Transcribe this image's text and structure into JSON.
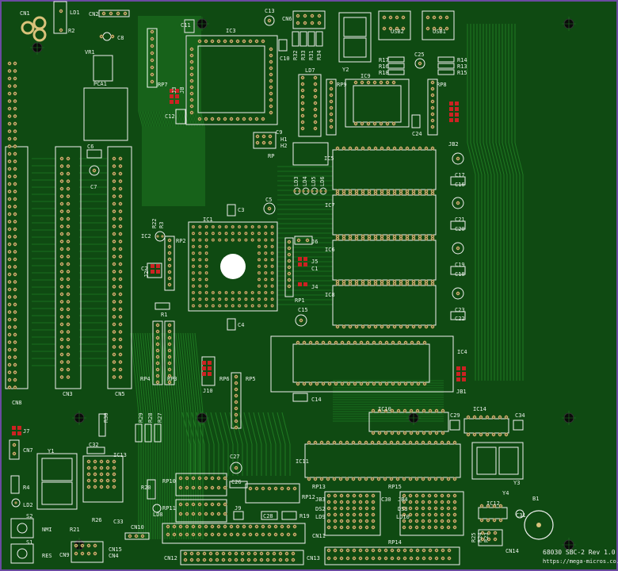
{
  "board": {
    "title": "68030 SBC-2 Rev 1.0",
    "url": "https://mega-micros.co.uk",
    "colors": {
      "substrate": "#0f4a12",
      "trace": "#1f7a22",
      "copper": "#d9c27a",
      "silk": "#f0f0f0",
      "jumper": "#cc2222",
      "hole": "#0a0a0a"
    }
  },
  "labels": {
    "cn1": "CN1",
    "ld1": "LD1",
    "r2": "R2",
    "cn2": "CN2",
    "c8": "C8",
    "vr1": "VR1",
    "pca1": "PCA1",
    "c11": "C11",
    "ic3": "IC3",
    "c13": "C13",
    "c10": "C10",
    "cn6": "CN6",
    "r32": "R32",
    "r33": "R33",
    "r31": "R31",
    "r34": "R34",
    "y2": "Y2",
    "usb2": "USB2",
    "usb1": "USB1",
    "c25": "C25",
    "r17": "R17",
    "r16": "R16",
    "r18": "R18",
    "r14": "R14",
    "r13": "R13",
    "r15": "R15",
    "rp7": "RP7",
    "j3": "J3",
    "jb": "JB",
    "c12": "C12",
    "ld7": "LD7",
    "rp9": "RP9",
    "ic9": "IC9",
    "rp8": "RP8",
    "c24": "C24",
    "jb2": "JB2",
    "c9": "C9",
    "h1": "H1",
    "h2": "H2",
    "rp": "RP",
    "ic5": "IC5",
    "ld3": "LD3",
    "ld4": "LD4",
    "ld5": "LD5",
    "ld6": "LD6",
    "c6": "C6",
    "c7": "C7",
    "cn8": "CN8",
    "cn3": "CN3",
    "cn5": "CN5",
    "c17": "C17",
    "c16": "C16",
    "c21": "C21",
    "c20": "C20",
    "c19": "C19",
    "c18": "C18",
    "c23": "C23",
    "c22": "C22",
    "ic7": "IC7",
    "ic6": "IC6",
    "ic8": "IC8",
    "c5": "C5",
    "c3": "C3",
    "ic1": "IC1",
    "r22": "R22",
    "r3": "R3",
    "ic2": "IC2",
    "rp2": "RP2",
    "c2": "C2",
    "j2": "J2",
    "r1": "R1",
    "j6": "J6",
    "j5": "J5",
    "c1": "C1",
    "j4": "J4",
    "rp1": "RP1",
    "c15": "C15",
    "c4": "C4",
    "ic4": "IC4",
    "jb1": "JB1",
    "rp4": "RP4",
    "rp3": "RP3",
    "rp6": "RP6",
    "rp5": "RP5",
    "j10": "J10",
    "c14": "C14",
    "j7": "J7",
    "cn7": "CN7",
    "r30": "R30",
    "r29": "R29",
    "r28": "R28",
    "r27": "R27",
    "ic10": "IC10",
    "c29": "C29",
    "ic14": "IC14",
    "c34": "C34",
    "y1": "Y1",
    "c32": "C32",
    "ic13": "IC13",
    "r4": "R4",
    "ld2": "LD2",
    "s2": "S2",
    "nmi": "NMI",
    "s1": "S1",
    "res": "RES",
    "r20": "R20",
    "rp10": "RP10",
    "ld8": "LD8",
    "rp11": "RP11",
    "c27": "C27",
    "c26": "C26",
    "ic11": "IC11",
    "rp12": "RP12",
    "y3": "Y3",
    "y4": "Y4",
    "r21": "R21",
    "r26": "R26",
    "c33": "C33",
    "cn10": "CN10",
    "cn15": "CN15",
    "cn9": "CN9",
    "cn4": "CN4",
    "ic12": "IC12",
    "b1": "B1",
    "c31": "C31",
    "j9": "J9",
    "c28": "C28",
    "r19": "R19",
    "jb3": "JB3",
    "rp13": "RP13",
    "c30": "C30",
    "jb4": "JB4",
    "rp15": "RP15",
    "ds2": "DS2",
    "ld9": "LD9",
    "ds3": "DS3",
    "ld10": "LD10",
    "cn11": "CN11",
    "rp14": "RP14",
    "cn12": "CN12",
    "cn13": "CN13",
    "cn14": "CN14",
    "r25": "R25",
    "r24": "R24",
    "r23": "R23"
  }
}
